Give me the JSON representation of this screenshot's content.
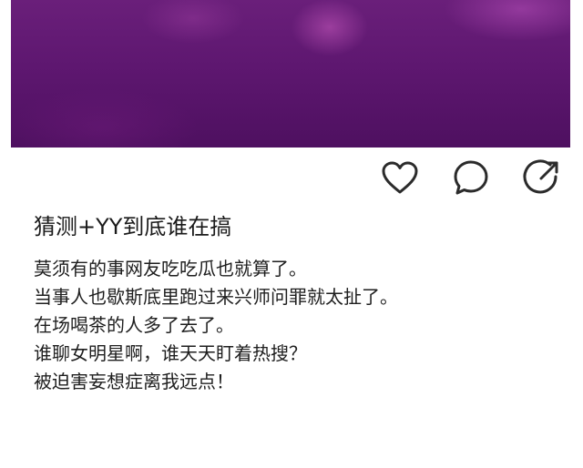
{
  "post": {
    "image": {
      "description_colors": [
        "#6a1f7a",
        "#5e1770",
        "#4e1060"
      ]
    },
    "actions": [
      {
        "icon": "heart-icon",
        "name": "like-button"
      },
      {
        "icon": "comment-bubble-icon",
        "name": "comment-button"
      },
      {
        "icon": "share-arrow-icon",
        "name": "share-button"
      }
    ],
    "title": "猜测+YY到底谁在搞",
    "lines": [
      "莫须有的事网友吃吃瓜也就算了。",
      "当事人也歇斯底里跑过来兴师问罪就太扯了。",
      "在场喝茶的人多了去了。",
      "谁聊女明星啊，谁天天盯着热搜？",
      "被迫害妄想症离我远点！"
    ]
  }
}
